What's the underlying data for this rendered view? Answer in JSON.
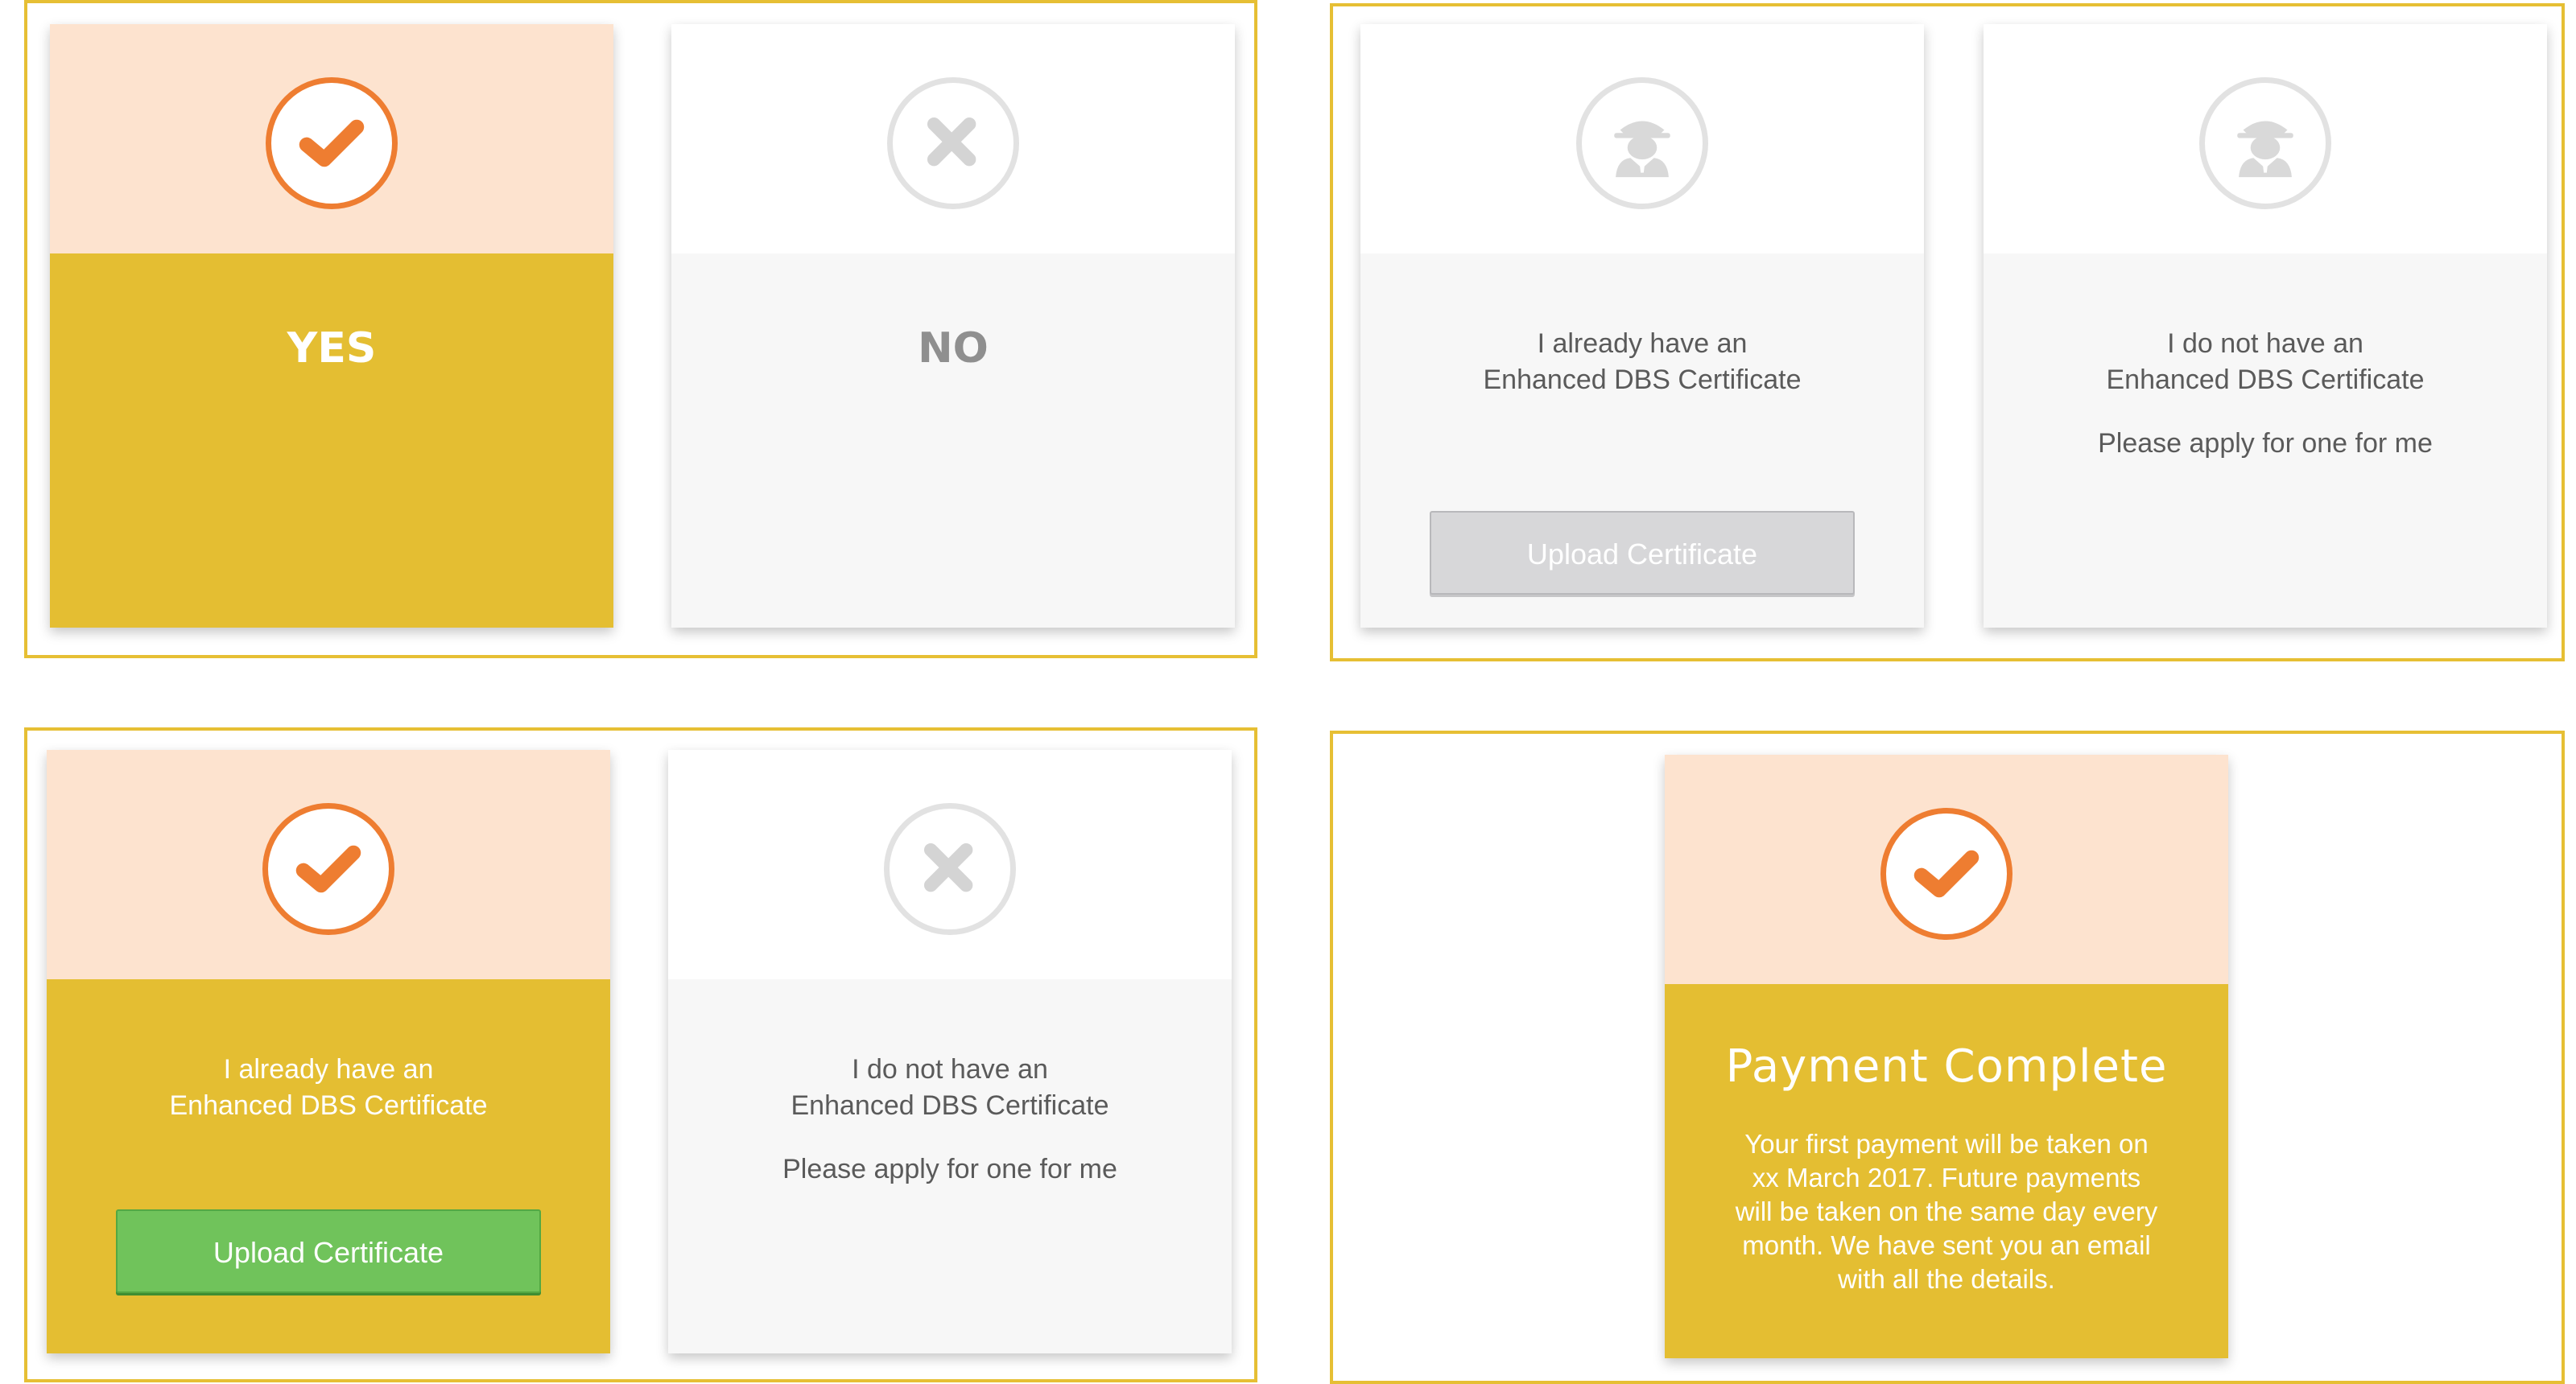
{
  "panels": {
    "yes_no": {
      "yes": {
        "label": "YES",
        "icon": "check-icon",
        "selected": true
      },
      "no": {
        "label": "NO",
        "icon": "cross-icon",
        "selected": false
      }
    },
    "dbs_unselected": {
      "have": {
        "icon": "spy-icon",
        "line1": "I already have an",
        "line2": "Enhanced DBS Certificate",
        "button": "Upload Certificate",
        "button_state": "disabled"
      },
      "not_have": {
        "icon": "spy-icon",
        "line1": "I do not have an",
        "line2": "Enhanced DBS Certificate",
        "line3": "Please apply for one for me"
      }
    },
    "dbs_selected": {
      "have": {
        "icon": "check-icon",
        "line1": "I already have an",
        "line2": "Enhanced DBS Certificate",
        "button": "Upload Certificate",
        "button_state": "enabled"
      },
      "not_have": {
        "icon": "cross-icon",
        "line1": "I do not have an",
        "line2": "Enhanced DBS Certificate",
        "line3": "Please apply for one for me"
      }
    },
    "payment": {
      "icon": "check-icon",
      "title": "Payment Complete",
      "desc_line1": "Your first payment will be taken on",
      "desc_line2": "xx March 2017. Future payments",
      "desc_line3": "will be taken on the same day every",
      "desc_line4": "month. We have sent you an email",
      "desc_line5": "with all the details."
    }
  },
  "colors": {
    "accent_orange": "#ee7d31",
    "selected_yellow": "#e4be32",
    "selected_peach": "#fde3cf",
    "frame_yellow": "#e6bf34",
    "upload_green": "#70c35b"
  }
}
